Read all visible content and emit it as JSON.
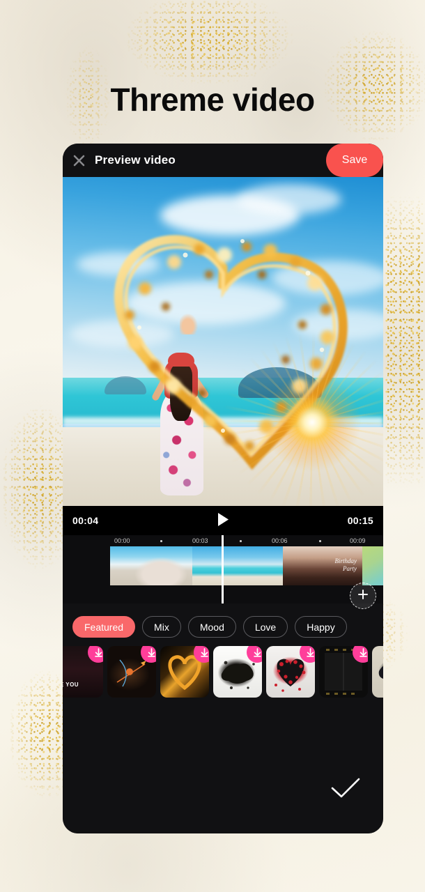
{
  "poster": {
    "headline": "Threme video",
    "background_color": "#f7f2e6",
    "accent_gold": "#d4a92e"
  },
  "app_bar": {
    "close_icon": "close-icon",
    "title": "Preview video",
    "save_label": "Save",
    "save_color": "#f9524e"
  },
  "preview": {
    "scene_description": "Woman in floral dress on beach with golden sparkle heart",
    "play_icon": "play-icon"
  },
  "transport": {
    "current_time": "00:04",
    "total_time": "00:15"
  },
  "timeline": {
    "ruler_marks": [
      "00:00",
      "00:03",
      "00:06",
      "00:09"
    ],
    "playhead_time": "00:04",
    "add_clip_icon": "plus-icon",
    "clips": [
      {
        "label": ""
      },
      {
        "label": ""
      },
      {
        "label": "Birthday\nParty"
      },
      {
        "label": ""
      }
    ]
  },
  "categories": {
    "active": "Featured",
    "items": [
      {
        "label": "Featured",
        "active": true
      },
      {
        "label": "Mix",
        "active": false
      },
      {
        "label": "Mood",
        "active": false
      },
      {
        "label": "Love",
        "active": false
      },
      {
        "label": "Happy",
        "active": false
      }
    ]
  },
  "themes": {
    "download_icon": "download-icon",
    "badge_color": "#ff3e9a",
    "items": [
      {
        "name": "love-you-theme",
        "caption": "VE YOU"
      },
      {
        "name": "cupid-theme",
        "caption": ""
      },
      {
        "name": "golden-heart-theme",
        "caption": ""
      },
      {
        "name": "ink-splash-theme",
        "caption": ""
      },
      {
        "name": "red-petal-heart-theme",
        "caption": ""
      },
      {
        "name": "film-strip-theme",
        "caption": ""
      },
      {
        "name": "ink-splatter-theme",
        "caption": ""
      },
      {
        "name": "edge-theme",
        "caption": ""
      }
    ]
  },
  "footer": {
    "confirm_icon": "check-icon"
  }
}
